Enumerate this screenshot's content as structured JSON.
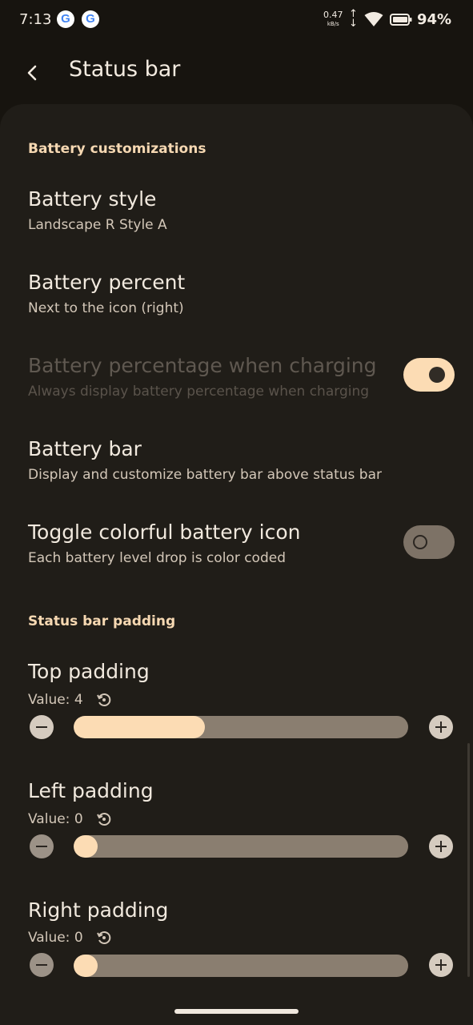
{
  "status_bar": {
    "time": "7:13",
    "notif_icons": [
      "G",
      "G"
    ],
    "net_rate": "0.47",
    "net_unit": "kB/s",
    "battery_pct": "94%"
  },
  "app_bar": {
    "title": "Status bar",
    "back_icon": "arrow-back-icon"
  },
  "sections": {
    "battery": {
      "header": "Battery customizations"
    },
    "padding": {
      "header": "Status bar padding"
    }
  },
  "rows": {
    "battery_style": {
      "title": "Battery style",
      "summary": "Landscape R Style A"
    },
    "battery_percent": {
      "title": "Battery percent",
      "summary": "Next to the icon (right)"
    },
    "charging_pct": {
      "title": "Battery percentage when charging",
      "summary": "Always display battery percentage when charging",
      "enabled": false,
      "checked": true
    },
    "battery_bar": {
      "title": "Battery bar",
      "summary": "Display and customize battery bar above status bar"
    },
    "colorful_icon": {
      "title": "Toggle colorful battery icon",
      "summary": "Each battery level drop is color coded",
      "checked": false
    }
  },
  "sliders": {
    "top": {
      "title": "Top padding",
      "value_label": "Value: 4",
      "level": 0.5
    },
    "left": {
      "title": "Left padding",
      "value_label": "Value: 0",
      "level": 0
    },
    "right": {
      "title": "Right padding",
      "value_label": "Value: 0",
      "level": 0
    }
  },
  "colors": {
    "accent": "#fcdcb4",
    "background": "#201d18",
    "track": "#8a7e70"
  }
}
